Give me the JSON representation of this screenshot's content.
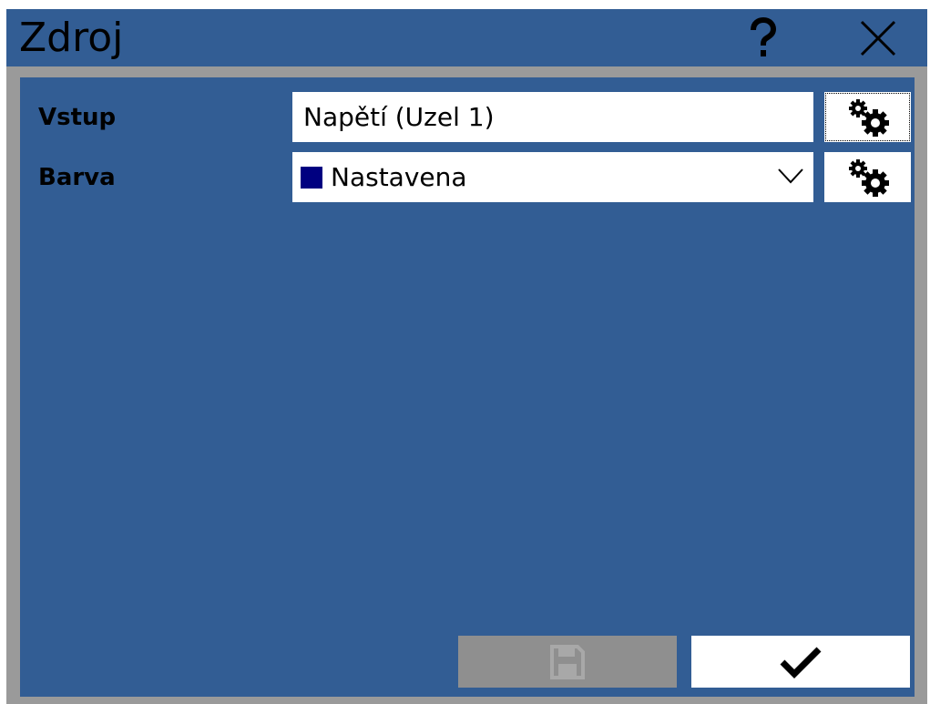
{
  "window": {
    "title": "Zdroj",
    "help_icon": "question-mark-icon",
    "close_icon": "close-x-icon"
  },
  "form": {
    "input": {
      "label": "Vstup",
      "value": "Napětí (Uzel 1)",
      "settings_icon": "gears-icon"
    },
    "color": {
      "label": "Barva",
      "value": "Nastavena",
      "swatch_color": "#000080",
      "settings_icon": "gears-icon"
    }
  },
  "footer": {
    "save_icon": "floppy-disk-icon",
    "save_enabled": false,
    "confirm_icon": "checkmark-icon"
  },
  "colors": {
    "panel": "#325d94",
    "frame": "#9a9a9a",
    "disabled_button": "#8f8f8f"
  }
}
